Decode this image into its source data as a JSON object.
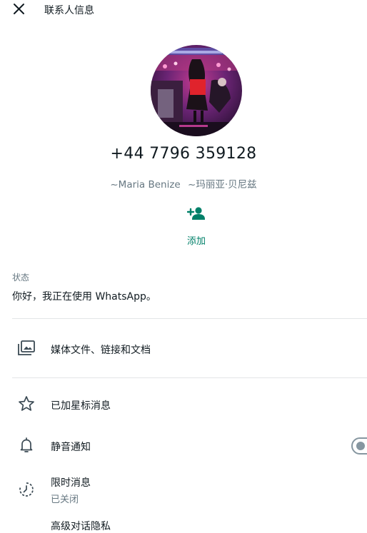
{
  "header": {
    "title": "联系人信息"
  },
  "contact": {
    "phone": "+44 7796 359128",
    "display_name": "~Maria Benize",
    "alt_name": "~玛丽亚·贝尼兹"
  },
  "add_action": {
    "label": "添加"
  },
  "about": {
    "label": "状态",
    "text": "你好，我正在使用 WhatsApp。"
  },
  "menu": {
    "media": "媒体文件、链接和文档",
    "starred": "已加星标消息",
    "mute": "静音通知",
    "disappearing": {
      "label": "限时消息",
      "sub": "已关闭"
    },
    "advanced_privacy": "高级对话隐私"
  },
  "toggles": {
    "mute_enabled": false
  },
  "colors": {
    "accent": "#008069",
    "secondary_text": "#667781",
    "divider": "#e3e5e7"
  }
}
